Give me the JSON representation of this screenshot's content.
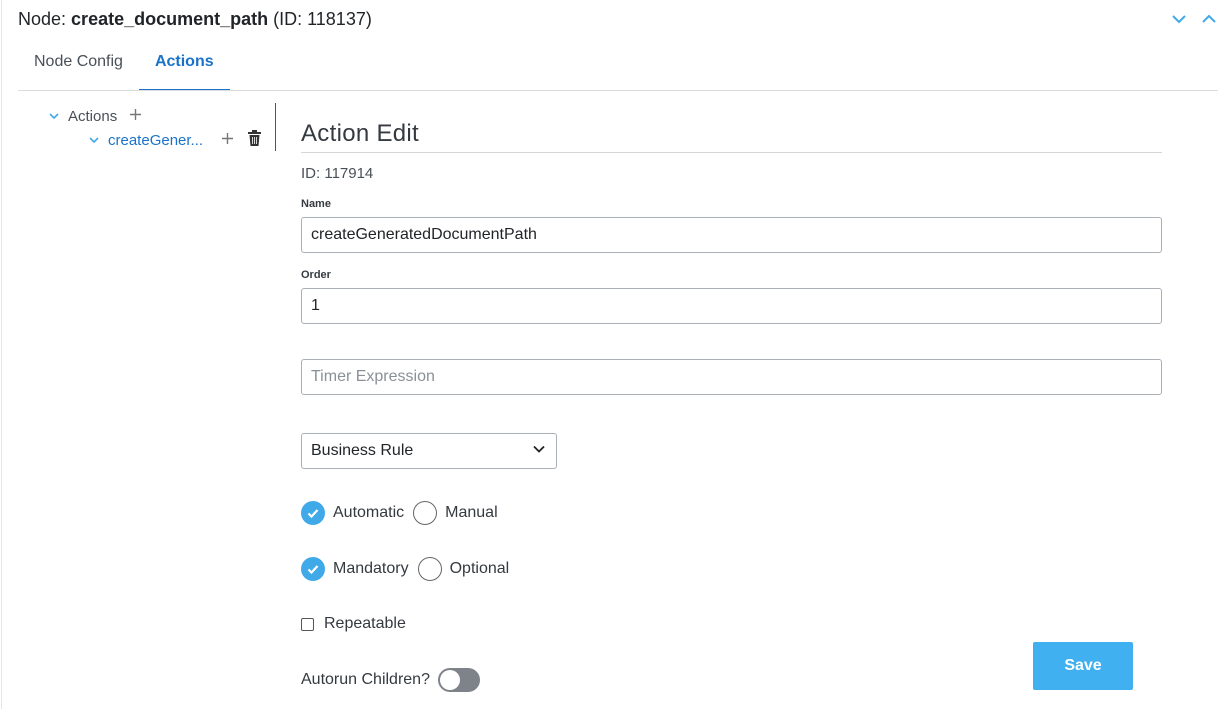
{
  "header": {
    "prefix": "Node: ",
    "node_name": "create_document_path",
    "id_text": " (ID: 118137)",
    "collapse_icon": "chevron-down-icon",
    "expand_icon": "chevron-up-icon"
  },
  "tabs": [
    {
      "label": "Node Config",
      "active": false
    },
    {
      "label": "Actions",
      "active": true
    }
  ],
  "tree": {
    "root_label": "Actions",
    "child_label": "createGener..."
  },
  "action_edit": {
    "title": "Action Edit",
    "id_line": "ID: 117914",
    "name_label": "Name",
    "name_value": "createGeneratedDocumentPath",
    "order_label": "Order",
    "order_value": "1",
    "timer_placeholder": "Timer Expression",
    "timer_value": "",
    "type_select": "Business Rule",
    "mode_options": [
      {
        "label": "Automatic",
        "checked": true
      },
      {
        "label": "Manual",
        "checked": false
      }
    ],
    "requirement_options": [
      {
        "label": "Mandatory",
        "checked": true
      },
      {
        "label": "Optional",
        "checked": false
      }
    ],
    "repeatable_label": "Repeatable",
    "repeatable_checked": false,
    "autorun_label": "Autorun Children?",
    "autorun_on": false,
    "save_label": "Save"
  },
  "colors": {
    "accent": "#1a73c8",
    "radio_checked": "#40a9e8",
    "save_button": "#40b0f0",
    "toggle_off": "#7d8389"
  }
}
